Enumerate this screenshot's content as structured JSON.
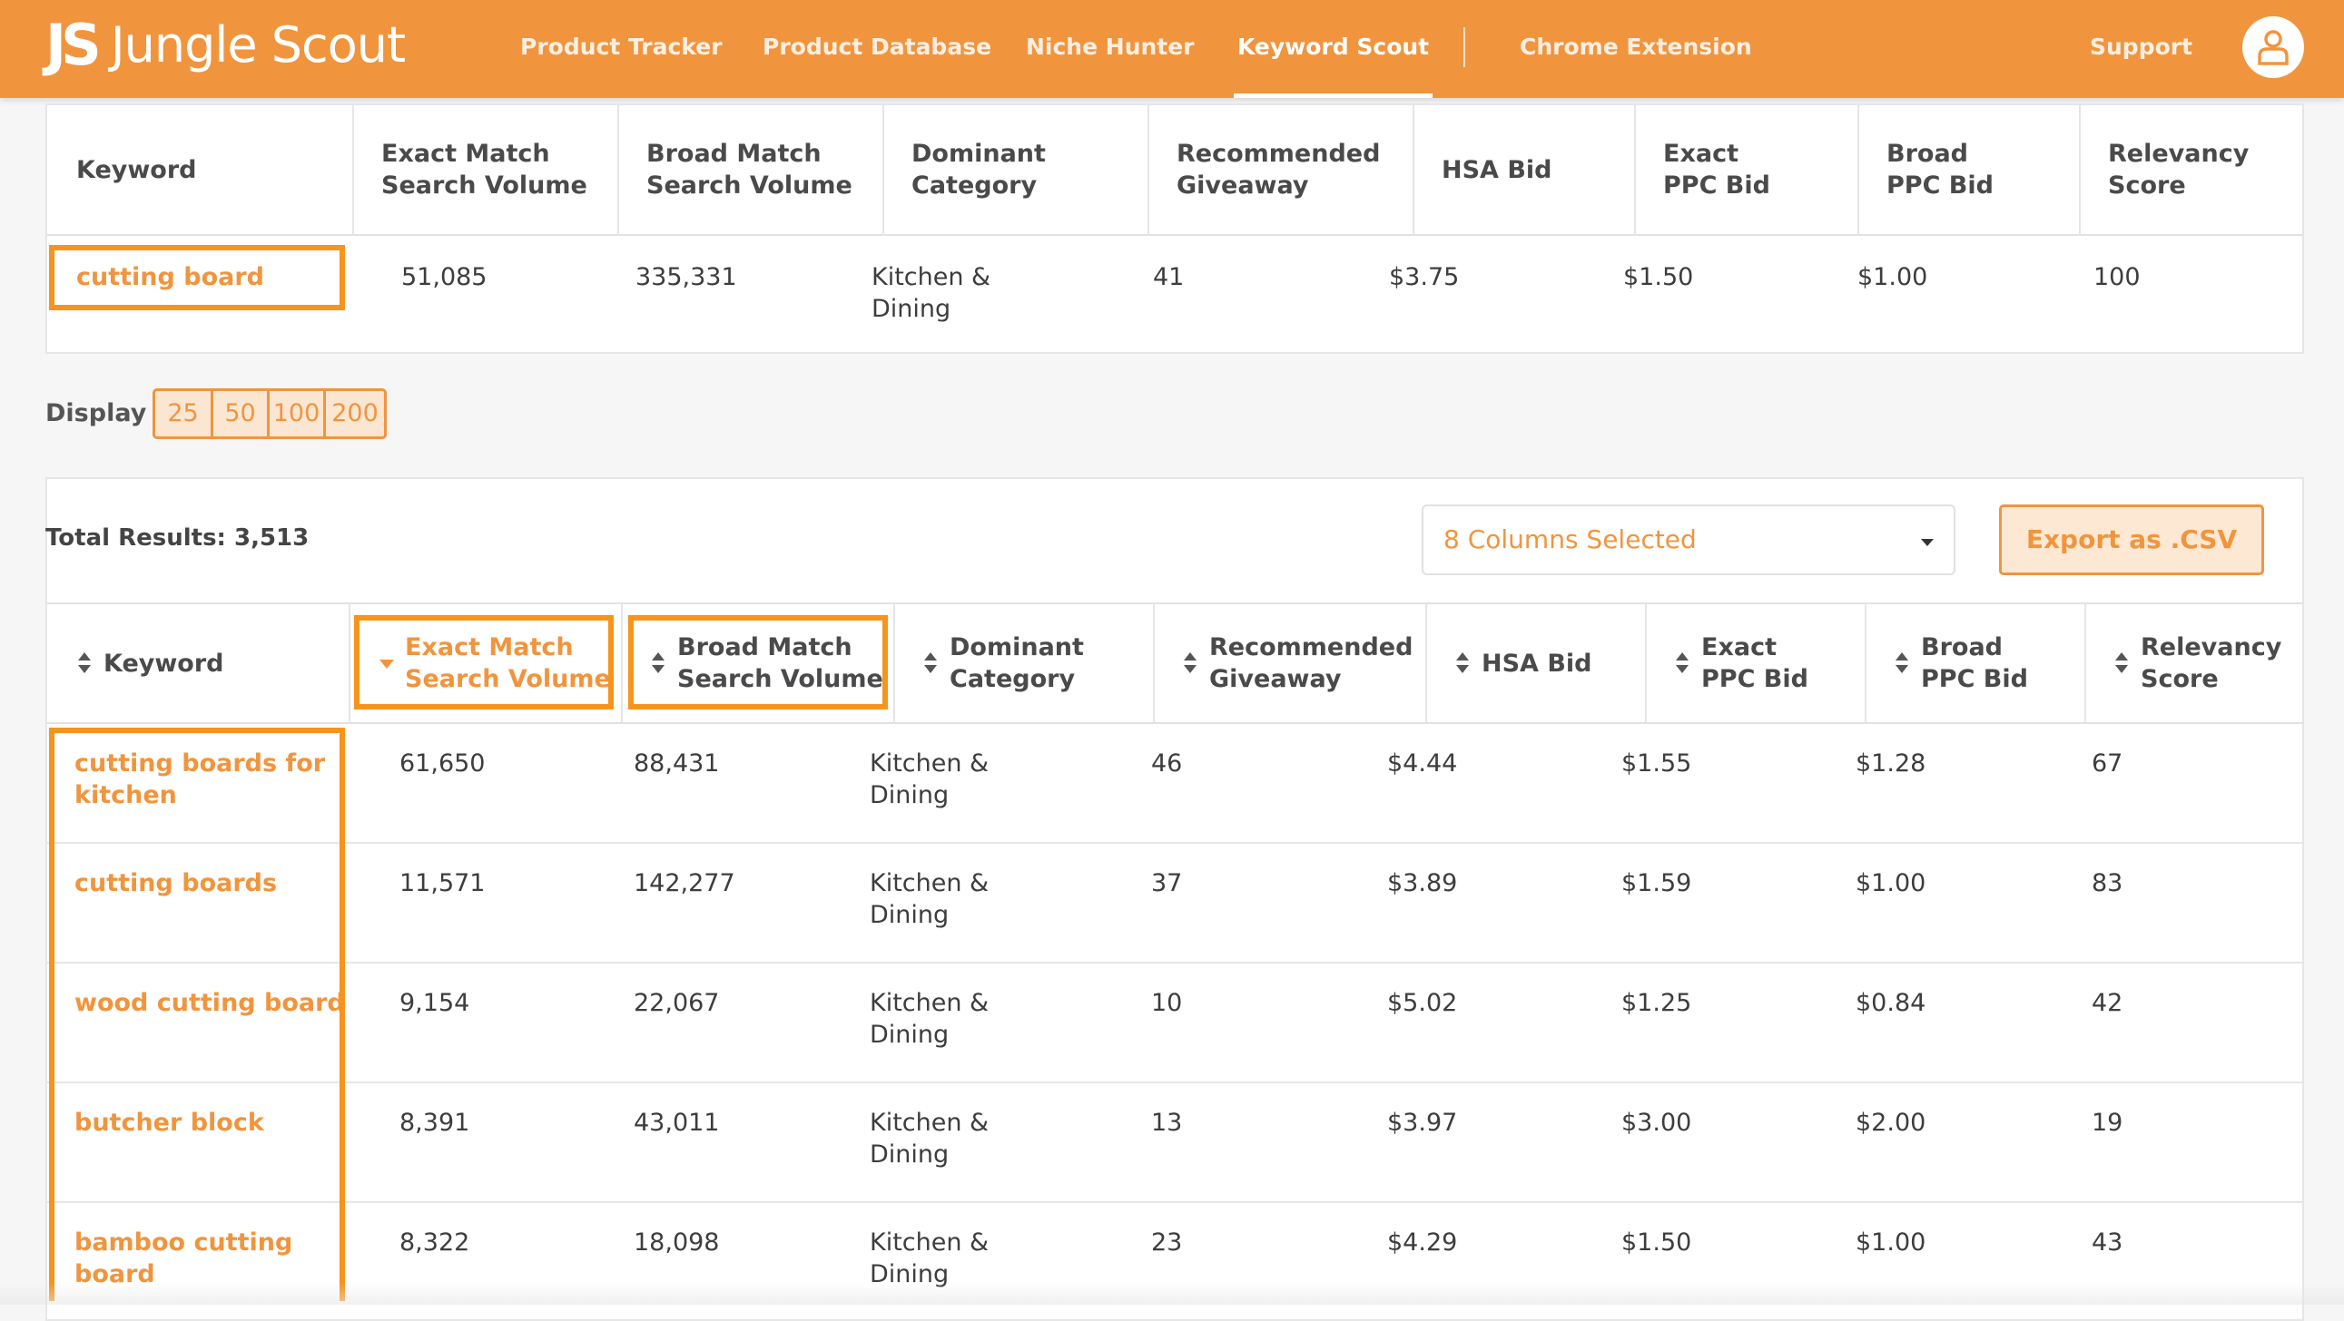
{
  "nav": {
    "logo_mark": "JS",
    "logo_text": "Jungle Scout",
    "links": [
      "Product Tracker",
      "Product Database",
      "Niche Hunter",
      "Keyword Scout",
      "Chrome Extension"
    ],
    "active": "Keyword Scout",
    "support": "Support"
  },
  "top_table": {
    "headers": [
      "Keyword",
      "Exact Match\nSearch Volume",
      "Broad Match\nSearch Volume",
      "Dominant\nCategory",
      "Recommended\nGiveaway",
      "HSA Bid",
      "Exact\nPPC Bid",
      "Broad\nPPC Bid",
      "Relevancy\nScore"
    ],
    "row": [
      "cutting board",
      "51,085",
      "335,331",
      "Kitchen &\nDining",
      "41",
      "$3.75",
      "$1.50",
      "$1.00",
      "100"
    ]
  },
  "display": {
    "label": "Display",
    "options": [
      "25",
      "50",
      "100",
      "200"
    ],
    "selected": "25"
  },
  "results": {
    "total_label": "Total Results: 3,513",
    "columns_select": "8 Columns Selected",
    "export_label": "Export as .CSV",
    "headers": [
      "Keyword",
      "Exact Match\nSearch Volume",
      "Broad Match\nSearch Volume",
      "Dominant\nCategory",
      "Recommended\nGiveaway",
      "HSA Bid",
      "Exact\nPPC Bid",
      "Broad\nPPC Bid",
      "Relevancy\nScore"
    ],
    "rows": [
      [
        "cutting boards for\nkitchen",
        "61,650",
        "88,431",
        "Kitchen &\nDining",
        "46",
        "$4.44",
        "$1.55",
        "$1.28",
        "67"
      ],
      [
        "cutting boards",
        "11,571",
        "142,277",
        "Kitchen &\nDining",
        "37",
        "$3.89",
        "$1.59",
        "$1.00",
        "83"
      ],
      [
        "wood cutting board",
        "9,154",
        "22,067",
        "Kitchen &\nDining",
        "10",
        "$5.02",
        "$1.25",
        "$0.84",
        "42"
      ],
      [
        "butcher block",
        "8,391",
        "43,011",
        "Kitchen &\nDining",
        "13",
        "$3.97",
        "$3.00",
        "$2.00",
        "19"
      ],
      [
        "bamboo cutting\nboard",
        "8,322",
        "18,098",
        "Kitchen &\nDining",
        "23",
        "$4.29",
        "$1.50",
        "$1.00",
        "43"
      ]
    ]
  },
  "colors": {
    "brand": "#f0953e",
    "highlight": "#f7941d"
  }
}
